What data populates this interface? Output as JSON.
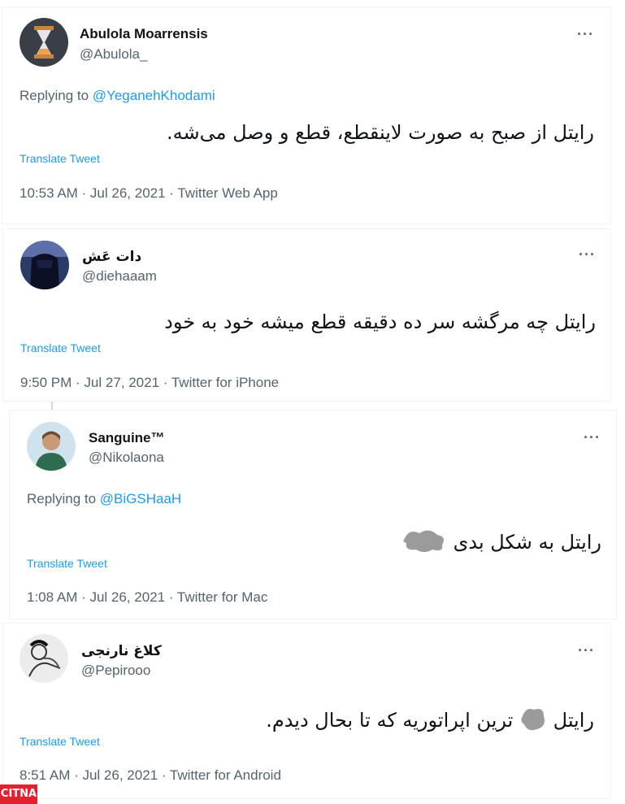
{
  "tweets": [
    {
      "name": "Abulola Moarrensis",
      "handle": "@Abulola_",
      "replying_prefix": "Replying to",
      "replying_to": "@YeganehKhodami",
      "text": "رایتل از صبح به صورت لاینقطع، قطع و وصل می‌شه.",
      "translate": "Translate Tweet",
      "meta": "10:53 AM · Jul 26, 2021 · Twitter Web App",
      "avatar": "hourglass-avatar"
    },
    {
      "name": "دات عَش",
      "handle": "@diehaaam",
      "text": "رایتل چه مرگشه سر ده دقیقه قطع میشه خود به خود",
      "translate": "Translate Tweet",
      "meta": "9:50 PM · Jul 27, 2021 · Twitter for iPhone",
      "avatar": "dark-figure-avatar"
    },
    {
      "name": "Sanguine™",
      "handle": "@Nikolaona",
      "replying_prefix": "Replying to",
      "replying_to": "@BiGSHaaH",
      "text": "رایتل به شکل بدی",
      "translate": "Translate Tweet",
      "meta": "1:08 AM · Jul 26, 2021 · Twitter for Mac",
      "avatar": "portrait-avatar"
    },
    {
      "name": "کلاغ نارنجی",
      "handle": "@Pepirooo",
      "text_part1": "رایتل",
      "text_part2": "ترین اپراتوریه که تا بحال دیدم.",
      "translate": "Translate Tweet",
      "meta": "8:51 AM · Jul 26, 2021 · Twitter for Android",
      "avatar": "sketch-avatar"
    }
  ],
  "more_icon": "more-options-icon",
  "watermark": "CITNA",
  "colors": {
    "link": "#1d9bf0",
    "secondary": "#536471",
    "primary": "#0f1419",
    "border": "#eff3f4",
    "brand": "#e4202e"
  }
}
